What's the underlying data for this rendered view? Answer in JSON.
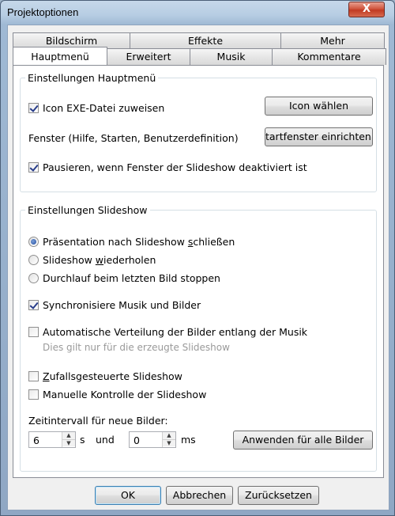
{
  "window": {
    "title": "Projektoptionen",
    "close_label": "X"
  },
  "tabs": {
    "row1": [
      "Bildschirm",
      "Effekte",
      "Mehr"
    ],
    "row2": [
      "Hauptmenü",
      "Erweitert",
      "Musik",
      "Kommentare"
    ]
  },
  "group_main": {
    "legend": "Einstellungen Hauptmenü",
    "icon_exe_label": "Icon EXE-Datei zuweisen",
    "icon_exe_checked": true,
    "icon_button": "Icon wählen",
    "window_label": "Fenster (Hilfe, Starten, Benutzerdefinition)",
    "window_button": "tartfenster einrichten.",
    "pause_label": "Pausieren, wenn Fenster der Slideshow deaktiviert ist",
    "pause_checked": true
  },
  "group_slideshow": {
    "legend": "Einstellungen Slideshow",
    "radio_close": {
      "prefix": "Präsentation nach Slideshow ",
      "access": "s",
      "suffix": "chließen",
      "checked": true
    },
    "radio_repeat": {
      "prefix": "Slideshow ",
      "access": "w",
      "suffix": "iederholen",
      "checked": false
    },
    "radio_stop": {
      "label": "Durchlauf beim letzten Bild stoppen",
      "checked": false
    },
    "sync_label": "Synchronisiere Musik und Bilder",
    "sync_checked": true,
    "auto_label": "Automatische Verteilung der Bilder entlang der Musik",
    "auto_checked": false,
    "auto_hint": "Dies gilt nur für die erzeugte Slideshow",
    "random": {
      "access": "Z",
      "suffix": "ufallsgesteuerte Slideshow",
      "checked": false
    },
    "manual_label": "Manuelle Kontrolle der Slideshow",
    "manual_checked": false,
    "interval_label": "Zeitintervall für neue Bilder:",
    "seconds_value": "6",
    "seconds_unit": "s",
    "and_label": "und",
    "ms_value": "0",
    "ms_unit": "ms",
    "apply_button": "Anwenden für alle Bilder"
  },
  "footer": {
    "ok": "OK",
    "cancel": "Abbrechen",
    "reset": "Zurücksetzen"
  }
}
